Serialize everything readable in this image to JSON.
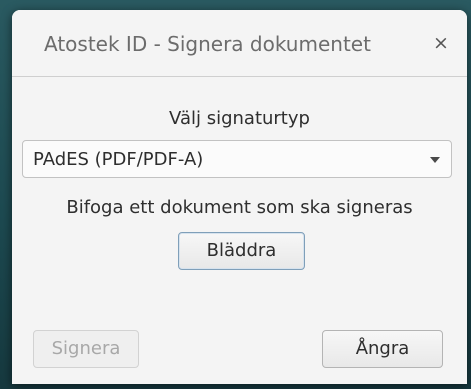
{
  "window": {
    "title": "Atostek ID - Signera dokumentet",
    "close_symbol": "×"
  },
  "form": {
    "prompt": "Välj signaturtyp",
    "signature_type": {
      "selected": "PAdES (PDF/PDF-A)"
    },
    "instruction": "Bifoga ett dokument som ska signeras",
    "browse_label": "Bläddra"
  },
  "footer": {
    "sign_label": "Signera",
    "cancel_label": "Ångra"
  },
  "icons": {
    "close": "close-icon",
    "dropdown": "chevron-down-icon"
  },
  "colors": {
    "background": "#1f4a52",
    "dialog": "#f4f4f4",
    "disabled_text": "#a8a8a8"
  }
}
